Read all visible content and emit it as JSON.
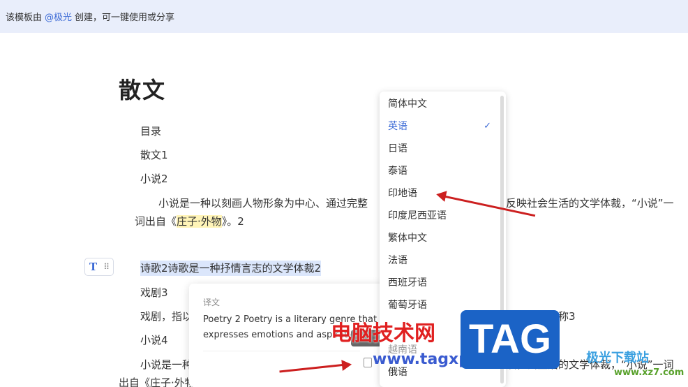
{
  "banner": {
    "prefix": "该模板由",
    "author": "@极光",
    "suffix": "创建，可一键使用或分享"
  },
  "doc": {
    "title": "散文",
    "toc": "目录",
    "item1": "散文1",
    "item2": "小说2",
    "para1": "小说是一种以刻画人物形象为中心、通过完整",
    "para1_tail": "反映社会生活的文学体裁，“小说”一",
    "para1_line2_prefix": "词出自《",
    "para1_line2_quote": "庄子·外物",
    "para1_line2_suffix": "》。2",
    "selected": "诗歌2诗歌是一种抒情言志的文学体裁2",
    "item3": "戏剧3",
    "para3": "戏剧，指以",
    "para3_tail": "演艺术的总称3",
    "item4": "小说4",
    "para4": "小说是一种",
    "para4_tail": "映社会生活的文学体裁，“小说”一词",
    "para4_line2": "出自《庄子·外物》。4"
  },
  "popup": {
    "label": "译文",
    "text": "Poetry 2 Poetry is a literary genre that expresses emotions and aspirations 2"
  },
  "languages": {
    "items": [
      "简体中文",
      "英语",
      "日语",
      "泰语",
      "印地语",
      "印度尼西亚语",
      "繁体中文",
      "法语",
      "西班牙语",
      "葡萄牙语",
      "",
      "越南语",
      "俄语"
    ],
    "selected": "英语",
    "check": "✓"
  },
  "watermarks": {
    "cn": "电脑技术网",
    "url": "www.tagxp.com",
    "tag": "TAG",
    "site": "极光下载站",
    "site2": "www.xz7.com"
  },
  "colors": {
    "accent": "#3d6bd6",
    "banner_bg": "#e9eefb",
    "arrow": "#cc1f1f"
  }
}
